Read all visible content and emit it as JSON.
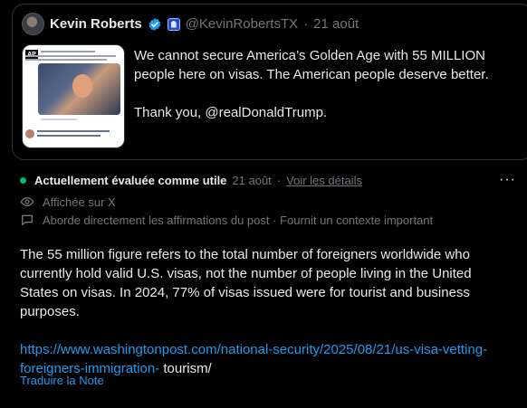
{
  "post": {
    "author_name": "Kevin Roberts",
    "handle": "@KevinRobertsTX",
    "separator": "·",
    "date": "21 août",
    "text_line1": "We cannot secure America’s Golden Age with 55 MILLION people here on visas. The American people deserve better.",
    "text_line2": "Thank you, @realDonaldTrump."
  },
  "note": {
    "status": "Actuellement évaluée comme utile",
    "date": "21 août",
    "separator": "·",
    "details_link": "Voir les détails",
    "more_label": "···",
    "shown_on": "Affichée sur X",
    "tags": "Aborde directement les affirmations du post · Fournit un contexte important",
    "body": "The 55 million figure refers to the total number of foreigners worldwide who currently hold valid U.S. visas, not the number of people living in the United States on visas. In 2024, 77% of visas issued were for tourist and business purposes.",
    "source_url": "https://www.washingtonpost.com/national-security/2025/08/21/us-visa-vetting-foreigners-immigration-",
    "source_tail": " tourism/",
    "translate": "Traduire la Note"
  },
  "colors": {
    "background": "#000000",
    "text": "#e7e9ea",
    "muted": "#71767b",
    "link": "#1d9bf0",
    "helpful_dot": "#00ba7c",
    "border": "#2f3336"
  }
}
